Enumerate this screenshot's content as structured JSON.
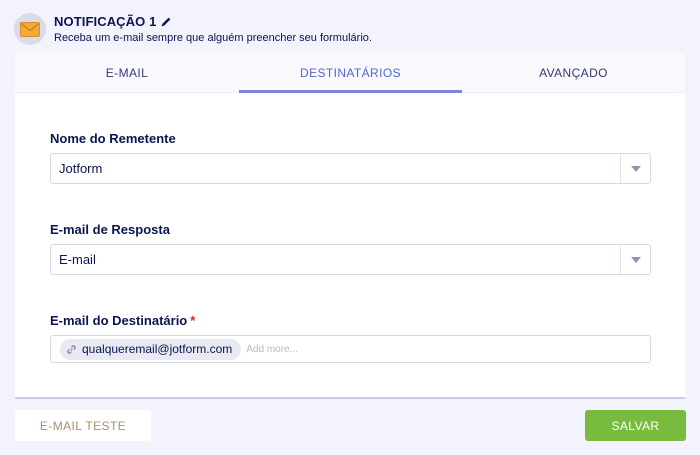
{
  "header": {
    "icon": "envelope-icon",
    "title": "NOTIFICAÇÃO 1",
    "edit_icon": "pencil-icon",
    "subtitle": "Receba um e-mail sempre que alguém preencher seu formulário."
  },
  "tabs": [
    {
      "label": "E-MAIL",
      "active": false
    },
    {
      "label": "DESTINATÁRIOS",
      "active": true
    },
    {
      "label": "AVANÇADO",
      "active": false
    }
  ],
  "form": {
    "sender_name": {
      "label": "Nome do Remetente",
      "value": "Jotform"
    },
    "reply_email": {
      "label": "E-mail de Resposta",
      "value": "E-mail"
    },
    "recipient_email": {
      "label": "E-mail do Destinatário",
      "required_mark": "*",
      "tags": [
        "qualqueremail@jotform.com"
      ],
      "placeholder": "Add more..."
    }
  },
  "footer": {
    "test_label": "E-MAIL TESTE",
    "save_label": "SALVAR"
  },
  "colors": {
    "accent": "#7b86d6",
    "save": "#78bb3f",
    "test_text": "#a8906e",
    "required": "#e02222",
    "background": "#f3f3fe"
  }
}
